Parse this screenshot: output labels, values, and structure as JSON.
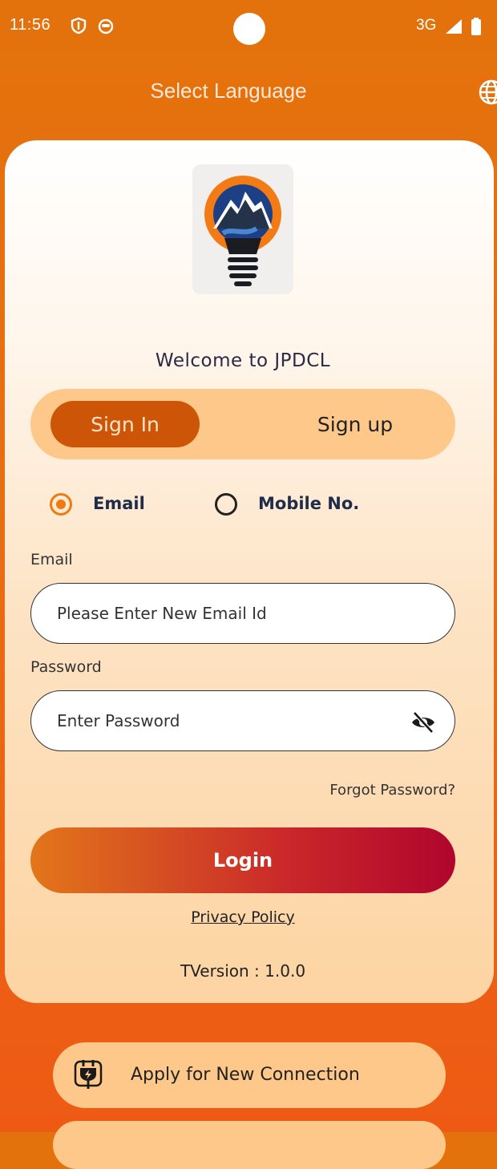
{
  "status_bar": {
    "time": "11:56",
    "network": "3G"
  },
  "header": {
    "title": "Select Language"
  },
  "welcome": "Welcome to JPDCL",
  "tabs": {
    "sign_in": "Sign In",
    "sign_up": "Sign up"
  },
  "login_type": {
    "options": [
      "Email",
      "Mobile No."
    ],
    "selected": "Email"
  },
  "email": {
    "label": "Email",
    "placeholder": "Please Enter New Email Id"
  },
  "password": {
    "label": "Password",
    "placeholder": "Enter Password"
  },
  "forgot_password": "Forgot Password?",
  "login_button": "Login",
  "privacy_policy": "Privacy Policy",
  "version": "TVersion  : 1.0.0",
  "bottom_action": {
    "label": "Apply for New Connection"
  },
  "colors": {
    "header_orange": "#e4720c",
    "tab_active": "#cd5508",
    "tab_bg": "#fdc889",
    "radio_accent": "#ef7a10",
    "login_start": "#e2761a",
    "login_end": "#b0052d"
  }
}
